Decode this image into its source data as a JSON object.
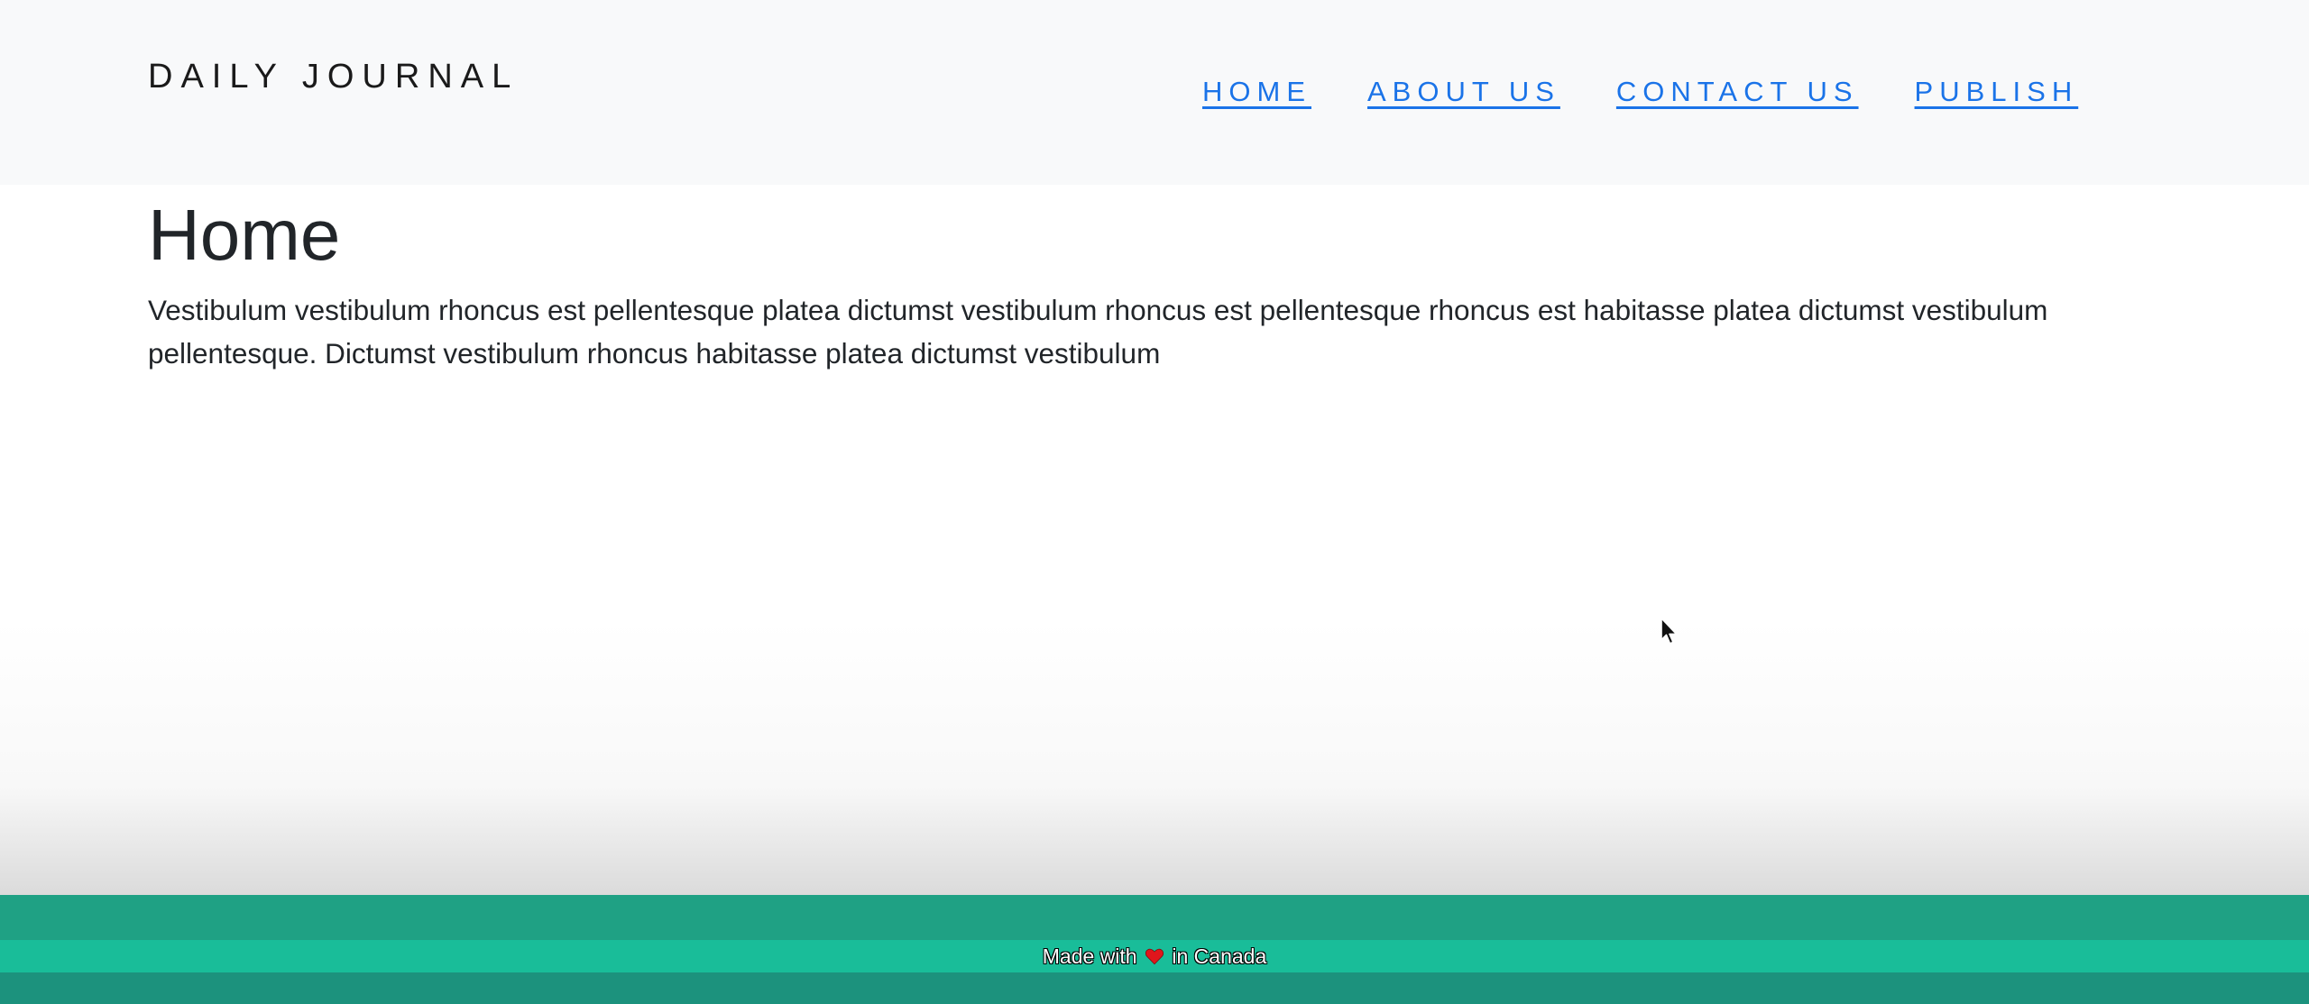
{
  "header": {
    "brand": "DAILY JOURNAL",
    "nav": [
      {
        "label": "HOME"
      },
      {
        "label": "ABOUT US"
      },
      {
        "label": "CONTACT US"
      },
      {
        "label": "PUBLISH"
      }
    ]
  },
  "main": {
    "title": "Home",
    "content": "Vestibulum vestibulum rhoncus est pellentesque platea dictumst vestibulum rhoncus est pellentesque rhoncus est habitasse platea dictumst vestibulum pellentesque. Dictumst vestibulum rhoncus habitasse platea dictumst vestibulum"
  },
  "footer": {
    "text_before": "Made with",
    "icon": "heart-icon",
    "text_after": "in Canada"
  },
  "colors": {
    "header_bg": "#f8f9fa",
    "link": "#1a73e8",
    "footer_accent": "#19bd99"
  }
}
